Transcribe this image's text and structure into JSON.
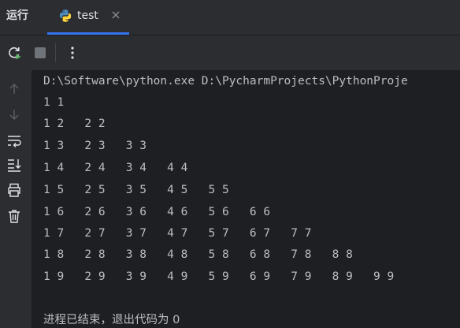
{
  "header": {
    "run_label": "运行",
    "tab_label": "test"
  },
  "colors": {
    "accent": "#3574f0",
    "run_icon": "#5fb865",
    "text": "#bcbec4"
  },
  "icons": {
    "tab_icon": "python-icon",
    "tab_close": "close-icon",
    "toolbar": [
      "rerun-icon",
      "stop-icon",
      "more-vertical-icon"
    ],
    "gutter": [
      "arrow-up-icon",
      "arrow-down-icon",
      "soft-wrap-icon",
      "scroll-to-end-icon",
      "print-icon",
      "trash-icon"
    ]
  },
  "console": {
    "command": "D:\\Software\\python.exe D:\\PycharmProjects\\PythonProje",
    "lines": [
      "1 1",
      "1 2   2 2",
      "1 3   2 3   3 3",
      "1 4   2 4   3 4   4 4",
      "1 5   2 5   3 5   4 5   5 5",
      "1 6   2 6   3 6   4 6   5 6   6 6",
      "1 7   2 7   3 7   4 7   5 7   6 7   7 7",
      "1 8   2 8   3 8   4 8   5 8   6 8   7 8   8 8",
      "1 9   2 9   3 9   4 9   5 9   6 9   7 9   8 9   9 9"
    ],
    "exit_message": "进程已结束，退出代码为 0"
  }
}
